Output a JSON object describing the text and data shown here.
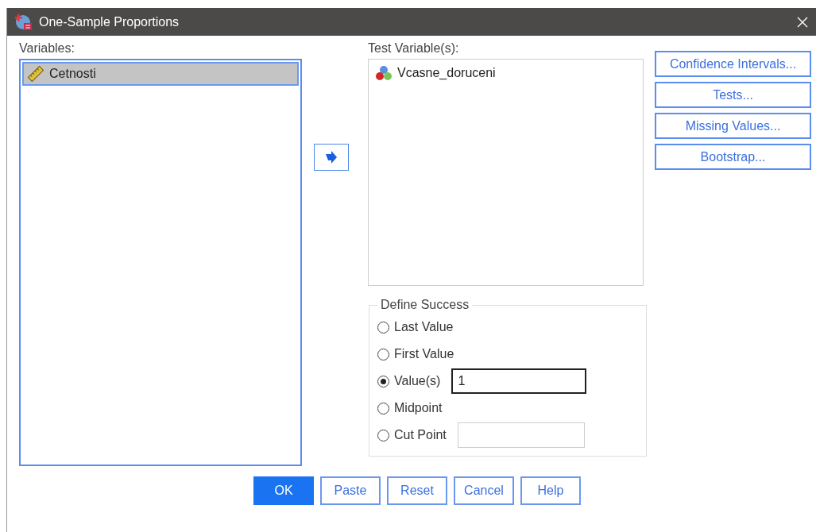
{
  "window": {
    "title": "One-Sample Proportions"
  },
  "variables": {
    "label": "Variables:",
    "items": [
      {
        "name": "Cetnosti",
        "kind": "scale",
        "selected": true
      }
    ]
  },
  "test_variables": {
    "label": "Test Variable(s):",
    "items": [
      {
        "name": "Vcasne_doruceni",
        "kind": "nominal",
        "selected": false
      }
    ]
  },
  "side_buttons": [
    "Confidence Intervals...",
    "Tests...",
    "Missing Values...",
    "Bootstrap..."
  ],
  "define_success": {
    "title": "Define Success",
    "options": [
      {
        "label": "Last Value",
        "selected": false
      },
      {
        "label": "First Value",
        "selected": false
      },
      {
        "label": "Value(s)",
        "selected": true,
        "value": "1",
        "kind": "field"
      },
      {
        "label": "Midpoint",
        "selected": false
      },
      {
        "label": "Cut Point",
        "selected": false,
        "kind": "field"
      }
    ]
  },
  "buttons": [
    {
      "label": "OK",
      "kind": "default"
    },
    {
      "label": "Paste",
      "kind": "normal"
    },
    {
      "label": "Reset",
      "kind": "normal"
    },
    {
      "label": "Cancel",
      "kind": "normal"
    },
    {
      "label": "Help",
      "kind": "normal"
    }
  ]
}
